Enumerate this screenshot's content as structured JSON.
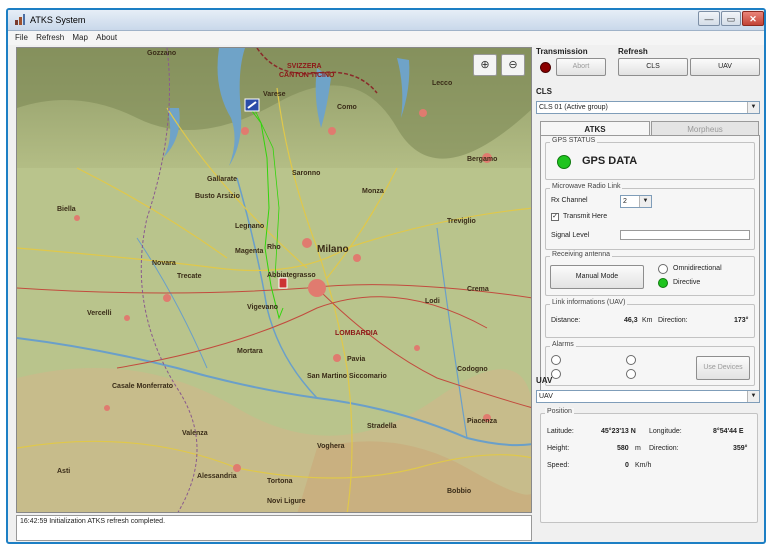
{
  "window": {
    "title": "ATKS System",
    "minimize": "—",
    "maximize": "▭",
    "close": "✕"
  },
  "menu": [
    "File",
    "Refresh",
    "Map",
    "About"
  ],
  "map": {
    "zoom_in_icon": "magnifier-plus-icon",
    "zoom_out_icon": "magnifier-minus-icon",
    "labels": {
      "svizzera": "SVIZZERA",
      "canton_ticino": "CANTON TICINO",
      "lecco": "Lecco",
      "bergamo": "Bergamo",
      "varese": "Varese",
      "como": "Como",
      "monza": "Monza",
      "milano": "Milano",
      "novara": "Novara",
      "vercelli": "Vercelli",
      "biella": "Biella",
      "pavia": "Pavia",
      "lodi": "Lodi",
      "crema": "Crema",
      "vigevano": "Vigevano",
      "saronno": "Saronno",
      "legnano": "Legnano",
      "abbiategrasso": "Abbiategrasso",
      "lombardia": "LOMBARDIA",
      "valenza": "Valenza",
      "alessandria": "Alessandria",
      "tortona": "Tortona",
      "voghera": "Voghera",
      "stradella": "Stradella",
      "piacenza": "Piacenza",
      "casale_monferrato": "Casale Monferrato",
      "asti": "Asti",
      "novi_ligure": "Novi Ligure",
      "busto_arsizio": "Busto Arsizio",
      "gallarate": "Gallarate",
      "treviglio": "Treviglio",
      "mortara": "Mortara",
      "castelnuovo": "San Martino Siccomario",
      "rho": "Rho",
      "codogno": "Codogno",
      "bobbio": "Bobbio",
      "gozzano": "Gozzano",
      "trecate": "Trecate",
      "magenta": "Magenta"
    }
  },
  "log": "16:42:59 Initialization ATKS refresh completed.",
  "transmission": {
    "label": "Transmission",
    "button": "Abort",
    "led_color": "#8b0000"
  },
  "refresh": {
    "label": "Refresh",
    "cls_button": "CLS",
    "uav_button": "UAV"
  },
  "cls": {
    "label": "CLS",
    "selected": "CLS 01 (Active group)"
  },
  "tabs": {
    "atks": "ATKS",
    "morpheus": "Morpheus"
  },
  "gps": {
    "label": "GPS STATUS",
    "value": "GPS DATA",
    "led_color": "#1fc41f"
  },
  "microwave": {
    "label": "Microwave Radio Link",
    "channel_label": "Rx Channel",
    "channel_value": "2",
    "transmit_label": "Transmit Here",
    "signal_label": "Signal Level"
  },
  "antenna": {
    "label": "Receiving antenna",
    "manual_button": "Manual Mode",
    "omni_label": "Omnidirectional",
    "directive_label": "Directive",
    "active_color": "#1fc41f"
  },
  "link": {
    "label": "Link informations (UAV)",
    "distance_label": "Distance:",
    "distance_value": "46,3",
    "distance_unit": "Km",
    "direction_label": "Direction:",
    "direction_value": "173°"
  },
  "alarms": {
    "label": "Alarms",
    "button": "Use Devices"
  },
  "uav": {
    "label": "UAV",
    "selected": "UAV",
    "position_label": "Position",
    "latitude_label": "Latitude:",
    "latitude_value": "45°23'13 N",
    "longitude_label": "Longitude:",
    "longitude_value": "8°54'44 E",
    "height_label": "Height:",
    "height_value": "580",
    "height_unit": "m",
    "direction_label": "Direction:",
    "direction_value": "359°",
    "speed_label": "Speed:",
    "speed_value": "0",
    "speed_unit": "Km/h"
  }
}
